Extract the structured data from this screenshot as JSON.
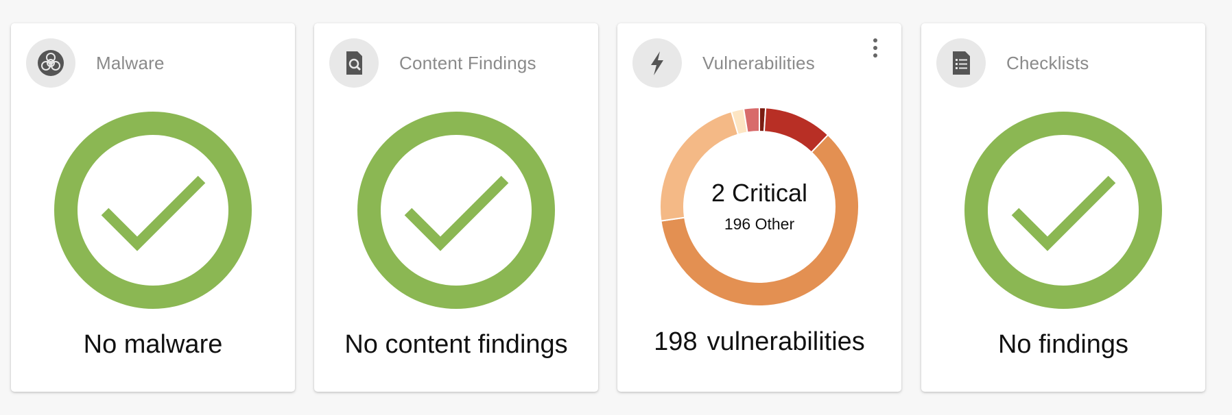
{
  "cards": [
    {
      "title": "Malware",
      "icon": "biohazard-icon",
      "caption": "No malware"
    },
    {
      "title": "Content Findings",
      "icon": "document-search-icon",
      "caption": "No content findings"
    },
    {
      "title": "Vulnerabilities",
      "icon": "lightning-bolt-icon",
      "caption_count": "198",
      "caption_label": "vulnerabilities",
      "donut_main": "2 Critical",
      "donut_sub": "196 Other",
      "more_icon": "more-vertical-icon"
    },
    {
      "title": "Checklists",
      "icon": "checklist-icon",
      "caption": "No findings"
    }
  ],
  "colors": {
    "success_green": "#8bb753",
    "icon_bg": "#e8e8e8",
    "icon_fg": "#555555",
    "title_gray": "#8a8a8a"
  },
  "chart_data": {
    "type": "pie",
    "title": "",
    "total": 198,
    "series": [
      {
        "name": "segment-1",
        "value": 2,
        "color": "#7a1d12"
      },
      {
        "name": "segment-2",
        "value": 22,
        "color": "#b82f25"
      },
      {
        "name": "segment-3",
        "value": 120,
        "color": "#e39052"
      },
      {
        "name": "segment-4",
        "value": 45,
        "color": "#f4b986"
      },
      {
        "name": "segment-5",
        "value": 4,
        "color": "#fde5c3"
      },
      {
        "name": "segment-6",
        "value": 5,
        "color": "#d86b6b"
      }
    ]
  }
}
